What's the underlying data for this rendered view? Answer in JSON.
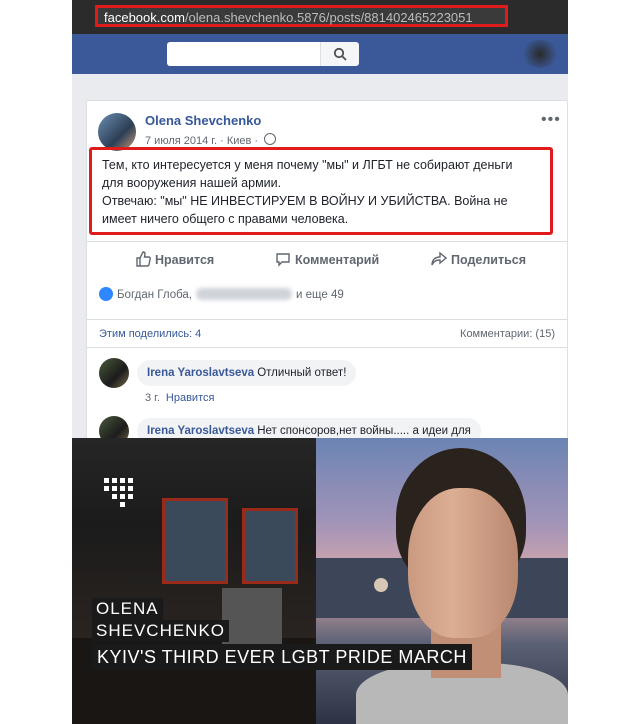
{
  "browser": {
    "url_host": "facebook.com",
    "url_path": "/olena.shevchenko.5876/posts/881402465223051",
    "highlight_color": "#e01b1b"
  },
  "header": {
    "brand_color": "#3b5998",
    "search_icon": "search-icon"
  },
  "post": {
    "author": "Olena Shevchenko",
    "date": "7 июля 2014 г.",
    "separator": "·",
    "location": "Киев",
    "privacy_icon": "globe-icon",
    "more": "•••",
    "text_lines": [
      "Тем, кто интересуется у меня почему \"мы\" и ЛГБТ не собирают деньги",
      "для вооружения нашей армии.",
      "Отвечаю: \"мы\" НЕ ИНВЕСТИРУЕМ В ВОЙНУ И УБИЙСТВА. Война не",
      "имеет ничего общего с правами человека."
    ],
    "actions": {
      "like": "Нравится",
      "comment": "Комментарий",
      "share": "Поделиться"
    },
    "reactions": {
      "first": "Богдан Глоба,",
      "more": "и еще 49"
    },
    "shares": "Этим поделились: 4",
    "comments_count": "Комментарии: (15)"
  },
  "comments": [
    {
      "author": "Irena Yaroslavtseva",
      "text": "Отличный ответ!",
      "time": "3 г.",
      "like": "Нравится"
    },
    {
      "author": "Irena Yaroslavtseva",
      "text": "Нет спонсоров,нет войны..... а идеи для"
    }
  ],
  "video": {
    "name_line1": "OLENA",
    "name_line2": "SHEVCHENKO",
    "title": "KYIV'S THIRD EVER LGBT PRIDE MARCH"
  }
}
